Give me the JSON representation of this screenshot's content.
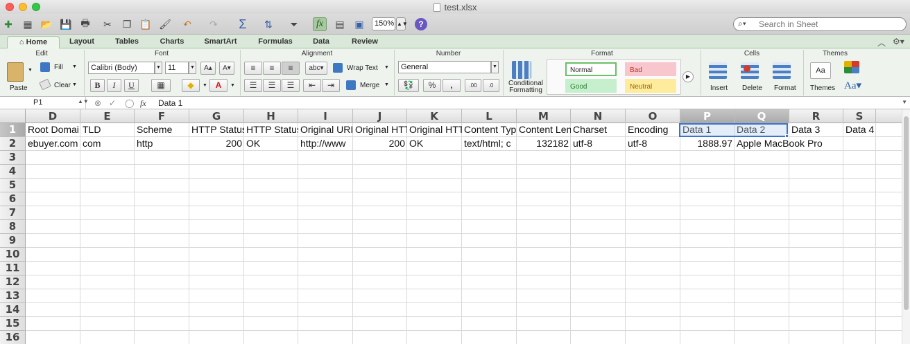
{
  "window": {
    "title": "test.xlsx"
  },
  "toolbar": {
    "zoom": "150%",
    "search_placeholder": "Search in Sheet",
    "icons": [
      "new-icon",
      "templates-icon",
      "open-icon",
      "save-icon",
      "print-icon",
      "cut-icon",
      "copy-icon",
      "paste-icon",
      "format-painter-icon",
      "undo-icon",
      "redo-icon",
      "autosum-icon",
      "sort-icon",
      "filter-icon",
      "formula-builder-icon",
      "show-toolbox-icon",
      "media-browser-icon",
      "help-icon"
    ]
  },
  "ribbon_tabs": [
    "Home",
    "Layout",
    "Tables",
    "Charts",
    "SmartArt",
    "Formulas",
    "Data",
    "Review"
  ],
  "ribbon": {
    "groups": {
      "edit": "Edit",
      "font": "Font",
      "alignment": "Alignment",
      "number": "Number",
      "format": "Format",
      "cells": "Cells",
      "themes": "Themes"
    },
    "edit": {
      "paste": "Paste",
      "fill": "Fill",
      "clear": "Clear"
    },
    "font": {
      "name": "Calibri (Body)",
      "size": "11",
      "bold": "B",
      "italic": "I",
      "underline": "U"
    },
    "alignment": {
      "wrap_text": "Wrap Text",
      "merge": "Merge",
      "abc": "abc"
    },
    "number": {
      "format": "General",
      "percent": "%",
      "comma": ","
    },
    "format": {
      "conditional_formatting": "Conditional Formatting",
      "styles": [
        {
          "label": "Normal",
          "bg": "#ffffff",
          "color": "#222222",
          "border": "#6abf69"
        },
        {
          "label": "Bad",
          "bg": "#f8c7ce",
          "color": "#c0392b",
          "border": "#f8c7ce"
        },
        {
          "label": "Good",
          "bg": "#c6efcd",
          "color": "#2e7d32",
          "border": "#c6efcd"
        },
        {
          "label": "Neutral",
          "bg": "#feeb9c",
          "color": "#9c6500",
          "border": "#feeb9c"
        }
      ]
    },
    "cells": {
      "insert": "Insert",
      "delete": "Delete",
      "format": "Format"
    },
    "themes": {
      "themes": "Themes",
      "fonts": "Aa"
    }
  },
  "formula_bar": {
    "name_box": "P1",
    "content": "Data 1",
    "fx": "fx"
  },
  "sheet": {
    "columns": [
      "D",
      "E",
      "F",
      "G",
      "H",
      "I",
      "J",
      "K",
      "L",
      "M",
      "N",
      "O",
      "P",
      "Q",
      "R",
      "S"
    ],
    "selected_columns": [
      "P",
      "Q"
    ],
    "rows": [
      "1",
      "2",
      "3",
      "4",
      "5",
      "6",
      "7",
      "8",
      "9",
      "10",
      "11",
      "12",
      "13",
      "14",
      "15",
      "16"
    ],
    "selected_rows": [
      "1"
    ],
    "row1": [
      "Root Domai",
      "TLD",
      "Scheme",
      "HTTP Status",
      "HTTP Status",
      "Original URI",
      "Original HTT",
      "Original HTT",
      "Content Typ",
      "Content Len",
      "Charset",
      "Encoding",
      "Data 1",
      "Data 2",
      "Data 3",
      "Data 4"
    ],
    "row2": [
      "ebuyer.com",
      "com",
      "http",
      "200",
      "OK",
      "http://www",
      "200",
      "OK",
      "text/html; c",
      "132182",
      "utf-8",
      "utf-8",
      "1888.97",
      "Apple MacBook Pro",
      "",
      ""
    ],
    "row2_numeric": [
      false,
      false,
      false,
      true,
      false,
      false,
      true,
      false,
      false,
      true,
      false,
      false,
      true,
      false,
      false,
      false
    ]
  }
}
